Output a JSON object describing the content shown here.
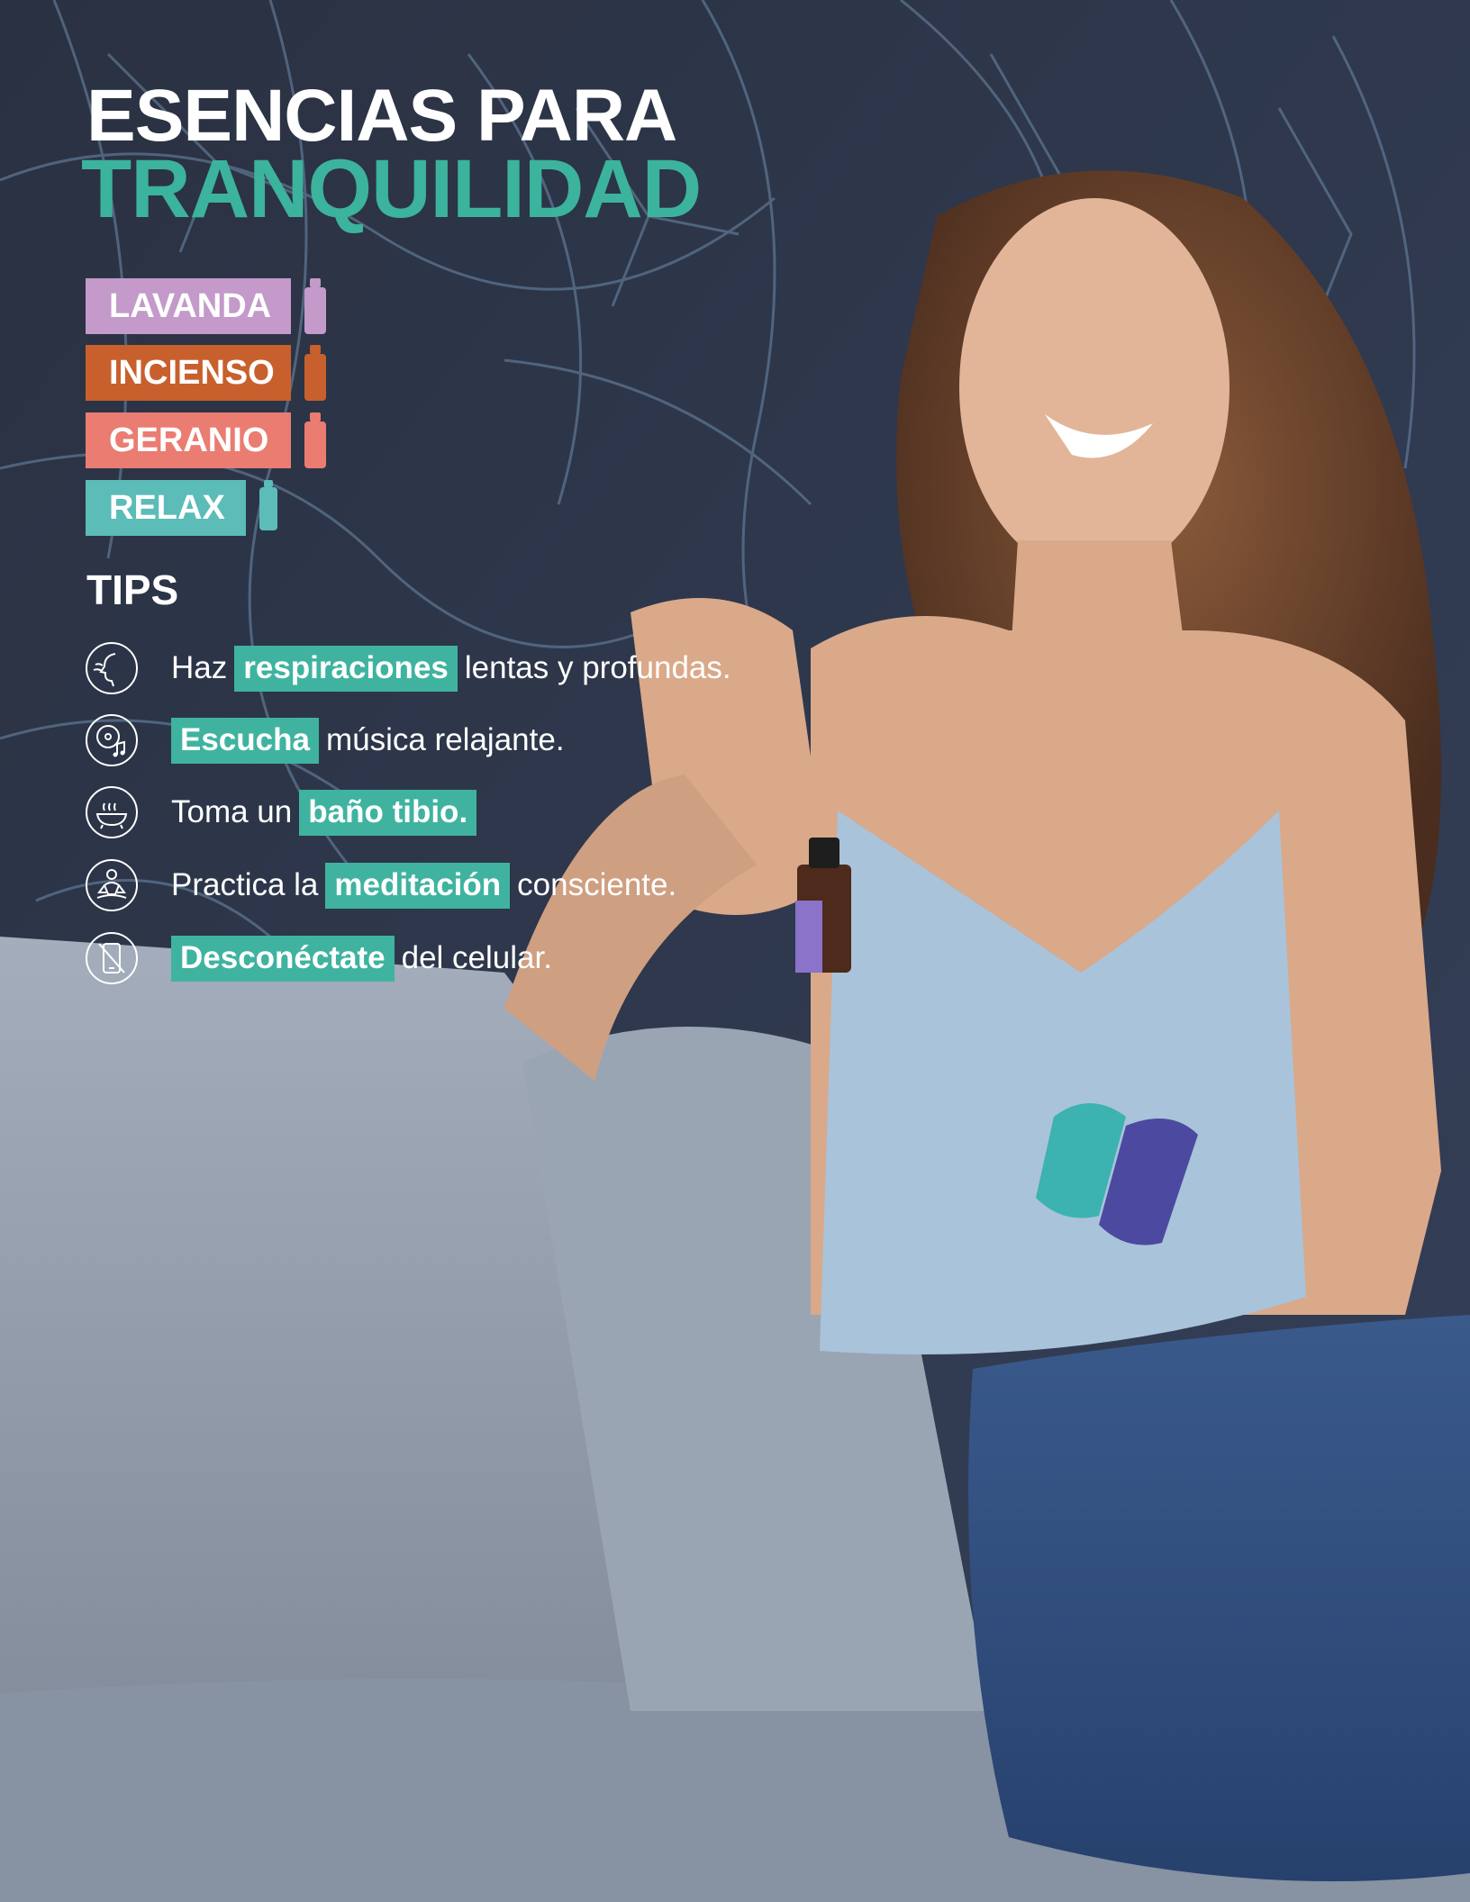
{
  "header": {
    "title_line1": "ESENCIAS PARA",
    "title_line2": "TRANQUILIDAD"
  },
  "essences": [
    {
      "label": "LAVANDA",
      "color": "#c39ac9"
    },
    {
      "label": "INCIENSO",
      "color": "#c8602d"
    },
    {
      "label": "GERANIO",
      "color": "#ea7c72"
    },
    {
      "label": "RELAX",
      "color": "#5bbcb8"
    }
  ],
  "tips_heading": "TIPS",
  "tips": [
    {
      "icon": "breath-icon",
      "before": "Haz",
      "highlight": "respiraciones",
      "after": "lentas y profundas."
    },
    {
      "icon": "music-icon",
      "before": "",
      "highlight": "Escucha",
      "after": "música relajante."
    },
    {
      "icon": "bath-icon",
      "before": "Toma un",
      "highlight": "baño tibio.",
      "after": ""
    },
    {
      "icon": "meditation-icon",
      "before": "Practica la",
      "highlight": "meditación",
      "after": "consciente."
    },
    {
      "icon": "no-phone-icon",
      "before": "",
      "highlight": "Desconéctate",
      "after": "del celular."
    }
  ],
  "colors": {
    "accent": "#3cb39c",
    "wallpaper": "#2b3447",
    "sofa": "#8c97a6"
  }
}
